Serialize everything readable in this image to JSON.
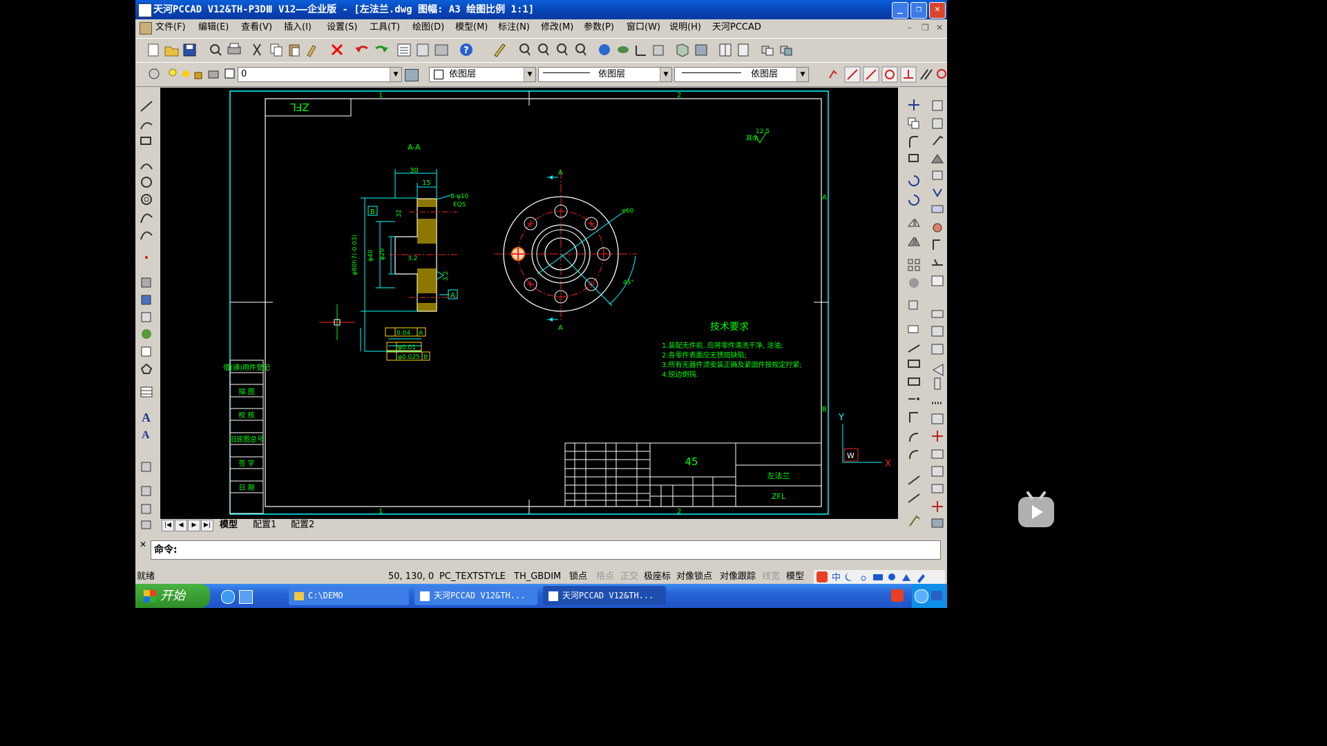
{
  "title": "天河PCCAD V12&TH-P3DⅢ V12——企业版 - [左法兰.dwg 图幅: A3 绘图比例 1:1]",
  "window_buttons": {
    "min": "_",
    "restore": "❐",
    "close": "✕"
  },
  "menu": [
    "文件(F)",
    "编辑(E)",
    "查看(V)",
    "插入(I)",
    "设置(S)",
    "工具(T)",
    "绘图(D)",
    "模型(M)",
    "标注(N)",
    "修改(M)",
    "参数(P)",
    "窗口(W)",
    "说明(H)",
    "天河PCCAD"
  ],
  "properties": {
    "layer": "0",
    "color": "依图层",
    "linetype": "依图层",
    "lineweight": "依图层"
  },
  "drawing": {
    "section_label": "A-A",
    "dim_30": "30",
    "dim_15": "15",
    "holes": "8-φ10",
    "eqs": "EQS",
    "datum_b": "B",
    "datum_a": "A",
    "dim_32": "32",
    "dim_phi20": "φ20",
    "dim_phi40": "φ40",
    "dim_phi80": "φ80h7(-0.03)",
    "rough_32": "3.2",
    "rough_32b": "3.2",
    "rough_125": "12.5",
    "rough_other": "其余",
    "tol_perp": "0.04",
    "tol_perp_ref": "A",
    "tol_round": "φ0.01",
    "tol_runout": "φ0.025",
    "tol_runout_ref": "B",
    "view_mark_a": "A",
    "dim_phi60": "φ60",
    "dim_45": "45°",
    "tech_title": "技术要求",
    "tech_lines": [
      "1.装配无件前, 应将零件清洗干净, 涂油;",
      "2.各零件表面应无锈斑缺陷;",
      "3.所有无器件须安装正确及紧固件按规定拧紧;",
      "4.锐边倒钝."
    ],
    "code_box": "ZFL",
    "zone_1": "1",
    "zone_2": "2",
    "zone_a": "A",
    "zone_b": "B",
    "side_labels": [
      "借(通)用件登记",
      "描 图",
      "校 核",
      "旧底图总号",
      "签 字",
      "日 期"
    ],
    "title_material": "45",
    "title_name": "左法兰",
    "title_code": "ZFL",
    "ucs_x": "X",
    "ucs_y": "Y",
    "ucs_w": "W"
  },
  "tabs": [
    "模型",
    "配置1",
    "配置2"
  ],
  "command": {
    "prompt": "命令:"
  },
  "status": {
    "ready": "就绪",
    "coords": "50, 130, 0",
    "textstyle": "PC_TEXTSTYLE",
    "dimstyle": "TH_GBDIM",
    "toggles": [
      {
        "label": "锁点",
        "on": true
      },
      {
        "label": "格点",
        "on": false
      },
      {
        "label": "正交",
        "on": false
      },
      {
        "label": "极座标",
        "on": true
      },
      {
        "label": "对像锁点",
        "on": true
      },
      {
        "label": "对像跟踪",
        "on": true
      },
      {
        "label": "线宽",
        "on": false
      },
      {
        "label": "模型",
        "on": true
      }
    ]
  },
  "taskbar": {
    "start": "开始",
    "tasks": [
      "C:\\DEMO",
      "天河PCCAD V12&TH...",
      "天河PCCAD V12&TH..."
    ]
  },
  "colors": {
    "cad_bg": "#000000",
    "frame": "#00ffff",
    "text": "#00ff00",
    "red": "#ff2020",
    "yellow": "#ffd800",
    "white": "#ffffff"
  }
}
